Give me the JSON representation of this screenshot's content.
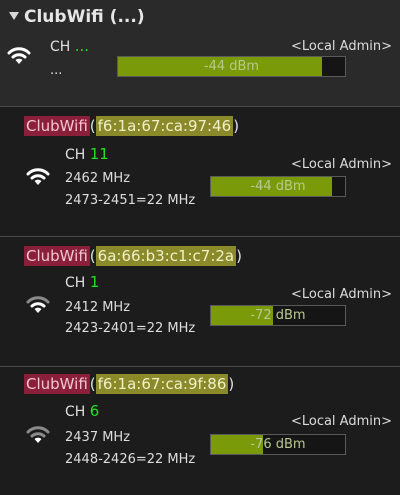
{
  "header": {
    "title": "ClubWifi (...)"
  },
  "summary": {
    "ch_label": "CH",
    "ch_value": "...",
    "freq": "...",
    "admin": "<Local Admin>",
    "signal_text": "-44 dBm",
    "signal_fill": 0.9
  },
  "networks": [
    {
      "ssid": "ClubWifi",
      "bssid": "f6:1a:67:ca:97:46",
      "ch_label": "CH",
      "channel": "11",
      "freq": "2462 MHz",
      "range": "2473-2451=22 MHz",
      "admin": "<Local Admin>",
      "signal_text": "-44 dBm",
      "signal_fill": 0.9
    },
    {
      "ssid": "ClubWifi",
      "bssid": "6a:66:b3:c1:c7:2a",
      "ch_label": "CH",
      "channel": "1",
      "freq": "2412 MHz",
      "range": "2423-2401=22 MHz",
      "admin": "<Local Admin>",
      "signal_text": "-72 dBm",
      "signal_fill": 0.46
    },
    {
      "ssid": "ClubWifi",
      "bssid": "f6:1a:67:ca:9f:86",
      "ch_label": "CH",
      "channel": "6",
      "freq": "2437 MHz",
      "range": "2448-2426=22 MHz",
      "admin": "<Local Admin>",
      "signal_text": "-76 dBm",
      "signal_fill": 0.39
    }
  ],
  "colors": {
    "ssid_bg": "#8a1f3a",
    "bssid_bg": "#8a8a2a",
    "channel": "#22e022",
    "signal_fill": "#7a9a0a"
  },
  "icons": {
    "wifi": "wifi-icon",
    "collapse": "triangle-down-icon"
  }
}
